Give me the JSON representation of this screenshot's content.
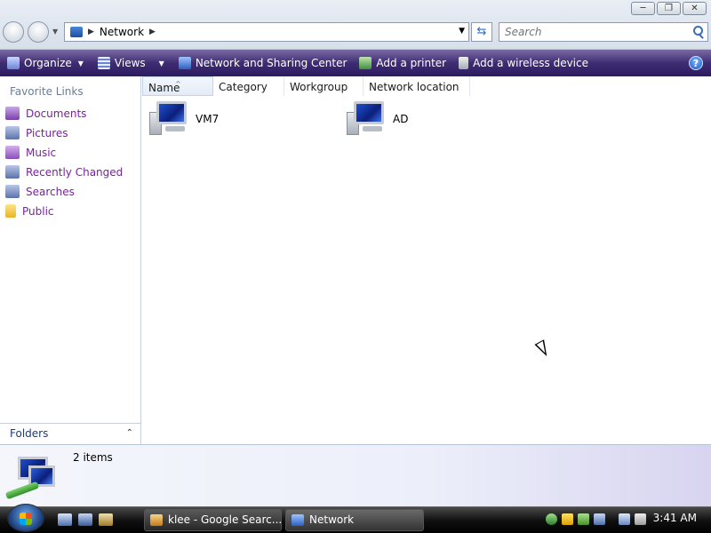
{
  "window": {
    "title_controls": [
      "minimize",
      "maximize",
      "close"
    ]
  },
  "address_bar": {
    "path": "Network",
    "search_placeholder": "Search"
  },
  "toolbar": {
    "items": [
      {
        "label": "Organize",
        "icon": "organize-icon",
        "has_dropdown": true
      },
      {
        "label": "Views",
        "icon": "views-icon",
        "has_dropdown": true
      },
      {
        "label": "Network and Sharing Center",
        "icon": "network-center-icon"
      },
      {
        "label": "Add a printer",
        "icon": "printer-icon"
      },
      {
        "label": "Add a wireless device",
        "icon": "wireless-device-icon"
      }
    ],
    "help_label": "?"
  },
  "sidebar": {
    "header": "Favorite Links",
    "items": [
      {
        "label": "Documents",
        "icon": "documents-icon",
        "color": "#7a3fa8"
      },
      {
        "label": "Pictures",
        "icon": "pictures-icon",
        "color": "#5c73a8"
      },
      {
        "label": "Music",
        "icon": "music-icon",
        "color": "#8a4fb8"
      },
      {
        "label": "Recently Changed",
        "icon": "recent-icon",
        "color": "#5c73a8"
      },
      {
        "label": "Searches",
        "icon": "searches-icon",
        "color": "#5c73a8"
      },
      {
        "label": "Public",
        "icon": "public-folder-icon",
        "color": "#e8b428"
      }
    ],
    "folders_label": "Folders"
  },
  "main": {
    "columns": [
      "Name",
      "Category",
      "Workgroup",
      "Network location"
    ],
    "sorted_column": "Name",
    "items": [
      {
        "label": "VM7",
        "icon": "computer-icon"
      },
      {
        "label": "AD",
        "icon": "computer-icon"
      }
    ]
  },
  "details": {
    "count": "2 items"
  },
  "taskbar": {
    "buttons": [
      {
        "label": "klee - Google Searc...",
        "icon": "firefox-icon"
      },
      {
        "label": "Network",
        "icon": "network-icon"
      }
    ],
    "clock": "3:41 AM"
  },
  "colors": {
    "toolbar_accent": "#3f2d74",
    "link_color": "#7a1fa2"
  }
}
